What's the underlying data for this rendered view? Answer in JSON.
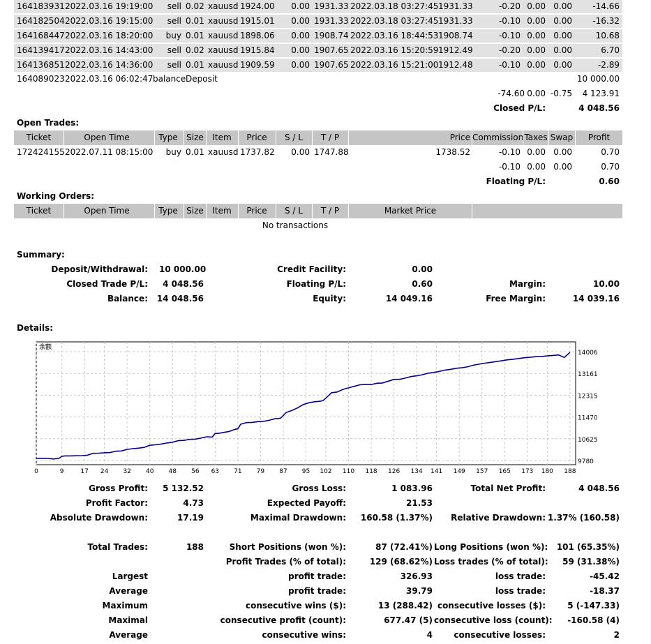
{
  "closed_rows": [
    {
      "ticket": "164183931",
      "time": "2022.03.16 19:19:00",
      "type": "sell",
      "size": "0.02",
      "item": "xauusd",
      "price": "1924.00",
      "sl": "0.00",
      "tp": "1931.33",
      "close_time": "2022.03.18 03:27:45",
      "close_price": "1931.33",
      "commission": "-0.20",
      "taxes": "0.00",
      "swap": "0.00",
      "profit": "-14.66"
    },
    {
      "ticket": "164182504",
      "time": "2022.03.16 19:15:00",
      "type": "sell",
      "size": "0.01",
      "item": "xauusd",
      "price": "1915.01",
      "sl": "0.00",
      "tp": "1931.33",
      "close_time": "2022.03.18 03:27:45",
      "close_price": "1931.33",
      "commission": "-0.10",
      "taxes": "0.00",
      "swap": "0.00",
      "profit": "-16.32"
    },
    {
      "ticket": "164168447",
      "time": "2022.03.16 18:20:00",
      "type": "buy",
      "size": "0.01",
      "item": "xauusd",
      "price": "1898.06",
      "sl": "0.00",
      "tp": "1908.74",
      "close_time": "2022.03.16 18:44:53",
      "close_price": "1908.74",
      "commission": "-0.10",
      "taxes": "0.00",
      "swap": "0.00",
      "profit": "10.68"
    },
    {
      "ticket": "164139417",
      "time": "2022.03.16 14:43:00",
      "type": "sell",
      "size": "0.02",
      "item": "xauusd",
      "price": "1915.84",
      "sl": "0.00",
      "tp": "1907.65",
      "close_time": "2022.03.16 15:20:59",
      "close_price": "1912.49",
      "commission": "-0.20",
      "taxes": "0.00",
      "swap": "0.00",
      "profit": "6.70"
    },
    {
      "ticket": "164136851",
      "time": "2022.03.16 14:36:00",
      "type": "sell",
      "size": "0.01",
      "item": "xauusd",
      "price": "1909.59",
      "sl": "0.00",
      "tp": "1907.65",
      "close_time": "2022.03.16 15:21:00",
      "close_price": "1912.48",
      "commission": "-0.10",
      "taxes": "0.00",
      "swap": "0.00",
      "profit": "-2.89"
    }
  ],
  "deposit_row": {
    "ticket": "164089023",
    "time": "2022.03.16 06:02:47",
    "type": "balance",
    "item": "Deposit",
    "profit": "10 000.00"
  },
  "closed_totals": {
    "commission": "-74.60",
    "taxes": "0.00",
    "swap": "-0.75",
    "profit": "4 123.91",
    "label": "Closed P/L:",
    "value": "4 048.56"
  },
  "open_trades": {
    "title": "Open Trades:",
    "headers": {
      "ticket": "Ticket",
      "time": "Open Time",
      "type": "Type",
      "size": "Size",
      "item": "Item",
      "price": "Price",
      "sl": "S / L",
      "tp": "T / P",
      "mprice": "Price",
      "commission": "Commission",
      "taxes": "Taxes",
      "swap": "Swap",
      "profit": "Profit"
    },
    "row": {
      "ticket": "172424155",
      "time": "2022.07.11 08:15:00",
      "type": "buy",
      "size": "0.01",
      "item": "xauusd",
      "price": "1737.82",
      "sl": "0.00",
      "tp": "1747.88",
      "mprice": "1738.52",
      "commission": "-0.10",
      "taxes": "0.00",
      "swap": "0.00",
      "profit": "0.70"
    },
    "totals": {
      "commission": "-0.10",
      "taxes": "0.00",
      "swap": "0.00",
      "profit": "0.70"
    },
    "floating_label": "Floating P/L:",
    "floating_value": "0.60"
  },
  "working_orders": {
    "title": "Working Orders:",
    "headers": {
      "ticket": "Ticket",
      "time": "Open Time",
      "type": "Type",
      "size": "Size",
      "item": "Item",
      "price": "Price",
      "sl": "S / L",
      "tp": "T / P",
      "market": "Market Price"
    },
    "empty": "No transactions"
  },
  "summary": {
    "title": "Summary:",
    "deposit_label": "Deposit/Withdrawal:",
    "deposit_value": "10 000.00",
    "credit_label": "Credit Facility:",
    "credit_value": "0.00",
    "closed_label": "Closed Trade P/L:",
    "closed_value": "4 048.56",
    "floating_label": "Floating P/L:",
    "floating_value": "0.60",
    "margin_label": "Margin:",
    "margin_value": "10.00",
    "balance_label": "Balance:",
    "balance_value": "14 048.56",
    "equity_label": "Equity:",
    "equity_value": "14 049.16",
    "free_margin_label": "Free Margin:",
    "free_margin_value": "14 039.16"
  },
  "details": {
    "title": "Details:"
  },
  "chart_data": {
    "type": "line",
    "title": "余额",
    "xlabel": "",
    "ylabel": "",
    "x_ticks": [
      "0",
      "9",
      "17",
      "24",
      "32",
      "40",
      "48",
      "56",
      "63",
      "71",
      "79",
      "87",
      "95",
      "102",
      "110",
      "118",
      "126",
      "134",
      "141",
      "149",
      "157",
      "165",
      "173",
      "180",
      "188"
    ],
    "y_ticks": [
      "14006",
      "13161",
      "12315",
      "11470",
      "10625",
      "9780"
    ],
    "ylim": [
      9780,
      14006
    ],
    "xlim": [
      0,
      190
    ],
    "grid": true,
    "line_color": "#00008b",
    "x": [
      0,
      2,
      4,
      6,
      8,
      9,
      10,
      12,
      14,
      16,
      18,
      20,
      22,
      24,
      26,
      28,
      30,
      32,
      34,
      36,
      38,
      40,
      42,
      44,
      46,
      48,
      50,
      52,
      54,
      56,
      58,
      60,
      62,
      63,
      64,
      66,
      68,
      70,
      71,
      72,
      74,
      76,
      78,
      80,
      82,
      84,
      86,
      87,
      88,
      90,
      92,
      94,
      96,
      98,
      100,
      101,
      102,
      104,
      106,
      108,
      110,
      112,
      114,
      116,
      118,
      120,
      122,
      124,
      126,
      128,
      130,
      132,
      134,
      136,
      138,
      140,
      142,
      144,
      146,
      148,
      150,
      152,
      154,
      156,
      158,
      160,
      162,
      164,
      166,
      168,
      170,
      172,
      174,
      176,
      178,
      180,
      182,
      184,
      186,
      188
    ],
    "y": [
      9860,
      9865,
      9860,
      9840,
      9860,
      9940,
      9960,
      9960,
      9965,
      9970,
      9985,
      10060,
      10065,
      10080,
      10090,
      10140,
      10150,
      10210,
      10240,
      10260,
      10290,
      10370,
      10390,
      10420,
      10460,
      10490,
      10550,
      10560,
      10600,
      10610,
      10650,
      10700,
      10690,
      10830,
      10830,
      10870,
      10910,
      10990,
      11010,
      11190,
      11250,
      11260,
      11290,
      11300,
      11340,
      11400,
      11420,
      11530,
      11640,
      11720,
      11820,
      11950,
      12020,
      12060,
      12080,
      12110,
      12200,
      12410,
      12440,
      12540,
      12600,
      12660,
      12720,
      12730,
      12730,
      12780,
      12790,
      12860,
      12930,
      12930,
      12980,
      13040,
      13070,
      13110,
      13170,
      13200,
      13240,
      13290,
      13320,
      13360,
      13380,
      13420,
      13480,
      13520,
      13560,
      13590,
      13620,
      13650,
      13690,
      13710,
      13740,
      13770,
      13790,
      13810,
      13820,
      13840,
      13860,
      13880,
      13780,
      13980
    ]
  },
  "stats": {
    "gross_profit_label": "Gross Profit:",
    "gross_profit": "5 132.52",
    "gross_loss_label": "Gross Loss:",
    "gross_loss": "1 083.96",
    "net_profit_label": "Total Net Profit:",
    "net_profit": "4 048.56",
    "profit_factor_label": "Profit Factor:",
    "profit_factor": "4.73",
    "expected_payoff_label": "Expected Payoff:",
    "expected_payoff": "21.53",
    "abs_dd_label": "Absolute Drawdown:",
    "abs_dd": "17.19",
    "max_dd_label": "Maximal Drawdown:",
    "max_dd": "160.58 (1.37%)",
    "rel_dd_label": "Relative Drawdown:",
    "rel_dd": "1.37% (160.58)",
    "total_trades_label": "Total Trades:",
    "total_trades": "188",
    "short_label": "Short Positions (won %):",
    "short": "87 (72.41%)",
    "long_label": "Long Positions (won %):",
    "long": "101 (65.35%)",
    "profit_trades_label": "Profit Trades (% of total):",
    "profit_trades": "129 (68.62%)",
    "loss_trades_label": "Loss trades (% of total):",
    "loss_trades": "59 (31.38%)",
    "largest_label": "Largest",
    "largest_profit_label": "profit trade:",
    "largest_profit": "326.93",
    "largest_loss_label": "loss trade:",
    "largest_loss": "-45.42",
    "average_label": "Average",
    "average_profit_label": "profit trade:",
    "average_profit": "39.79",
    "average_loss_label": "loss trade:",
    "average_loss": "-18.37",
    "maximum_label": "Maximum",
    "max_wins_label": "consecutive wins ($):",
    "max_wins": "13 (288.42)",
    "max_losses_label": "consecutive losses ($):",
    "max_losses": "5 (-147.33)",
    "maximal_label": "Maximal",
    "max_profit_label": "consecutive profit (count):",
    "max_profit": "677.47 (5)",
    "max_loss_label": "consecutive loss (count):",
    "max_loss": "-160.58 (4)",
    "average2_label": "Average",
    "avg_wins_label": "consecutive wins:",
    "avg_wins": "4",
    "avg_losses_label": "consecutive losses:",
    "avg_losses": "2"
  }
}
